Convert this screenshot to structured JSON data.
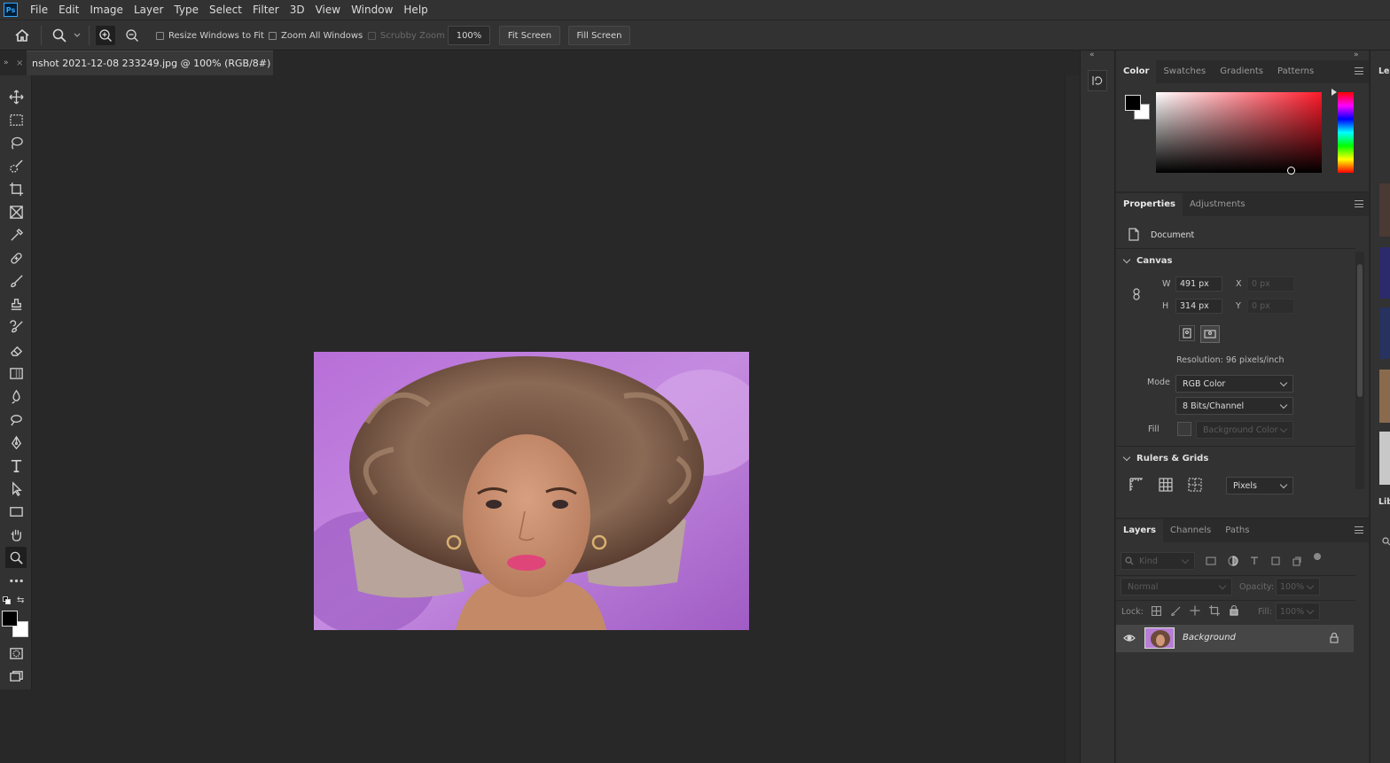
{
  "menu": [
    "File",
    "Edit",
    "Image",
    "Layer",
    "Type",
    "Select",
    "Filter",
    "3D",
    "View",
    "Window",
    "Help"
  ],
  "options": {
    "resize_windows": "Resize Windows to Fit",
    "zoom_all": "Zoom All Windows",
    "scrubby": "Scrubby Zoom",
    "zoom_value": "100%",
    "fit_screen": "Fit Screen",
    "fill_screen": "Fill Screen"
  },
  "document": {
    "tab_title": "nshot 2021-12-08 233249.jpg @ 100% (RGB/8#)"
  },
  "color_panel": {
    "tabs": [
      "Color",
      "Swatches",
      "Gradients",
      "Patterns"
    ],
    "foreground": "#000000",
    "background": "#ffffff",
    "hue": "#ff1a2a"
  },
  "properties": {
    "tabs": [
      "Properties",
      "Adjustments"
    ],
    "doc_label": "Document",
    "canvas_header": "Canvas",
    "w_label": "W",
    "w_value": "491 px",
    "h_label": "H",
    "h_value": "314 px",
    "x_label": "X",
    "x_placeholder": "0 px",
    "y_label": "Y",
    "y_placeholder": "0 px",
    "resolution": "Resolution: 96 pixels/inch",
    "mode_label": "Mode",
    "mode_value": "RGB Color",
    "bits_value": "8 Bits/Channel",
    "fill_label": "Fill",
    "fill_value": "Background Color",
    "rulers_header": "Rulers & Grids",
    "units": "Pixels"
  },
  "layers": {
    "tabs": [
      "Layers",
      "Channels",
      "Paths"
    ],
    "kind_placeholder": "Kind",
    "blend_mode": "Normal",
    "opacity_label": "Opacity:",
    "opacity_value": "100%",
    "lock_label": "Lock:",
    "fill_label": "Fill:",
    "fill_value": "100%",
    "layer_name": "Background"
  },
  "right_edge": {
    "tab1": "Lea",
    "tab2": "Lib"
  }
}
